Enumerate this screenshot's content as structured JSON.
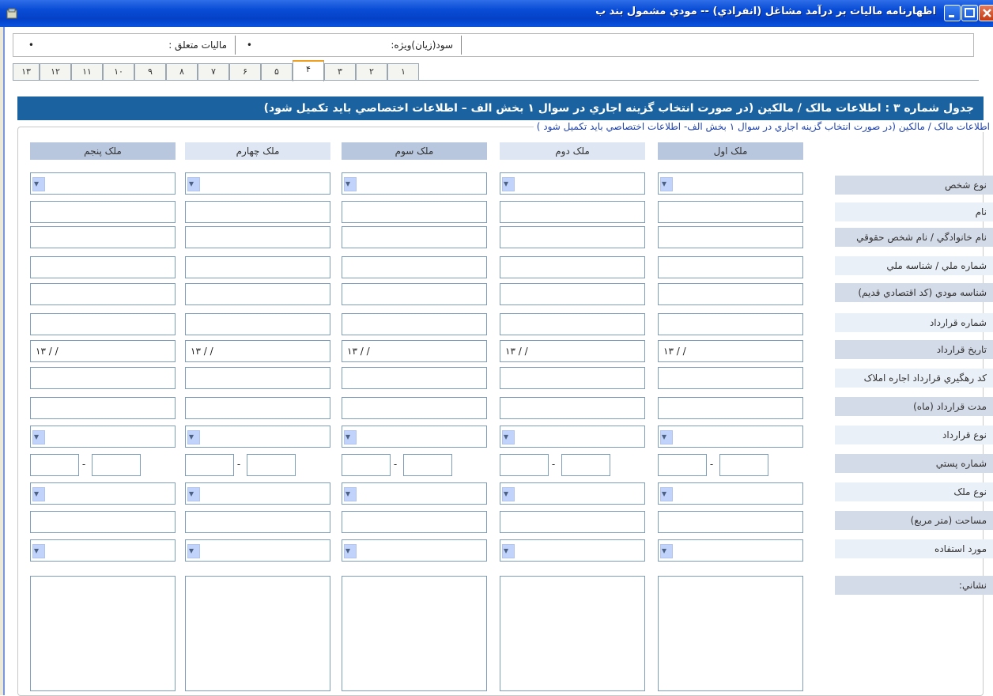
{
  "window": {
    "title": "اظهارنامه ماليات بر درآمد مشاغل (انفرادي) -- مودي مشمول بند ب"
  },
  "summary": {
    "profit_label": "سود(زيان)ويژه:",
    "profit_value": "•",
    "tax_label": "ماليات متعلق :",
    "tax_value": "•"
  },
  "tabs": [
    "۱",
    "۲",
    "۳",
    "۴",
    "۵",
    "۶",
    "۷",
    "۸",
    "۹",
    "۱۰",
    "۱۱",
    "۱۲",
    "۱۳"
  ],
  "active_tab": "۴",
  "section": {
    "header": "جدول شماره ۳ : اطلاعات مالک / مالکين (در صورت انتخاب گزينه اجاري در سوال ۱ بخش الف – اطلاعات اختصاصي بايد تکميل شود)",
    "group_label": "اطلاعات مالک / مالکين (در صورت انتخاب گزينه اجاري در سوال ۱ بخش الف- اطلاعات اختصاصي بايد تکميل شود )"
  },
  "columns": [
    "ملک اول",
    "ملک دوم",
    "ملک سوم",
    "ملک چهارم",
    "ملک پنجم"
  ],
  "rows": {
    "person_type": "نوع شخص",
    "name": "نام",
    "family": "نام خانوادگي / نام شخص حقوقي",
    "national_id": "شماره ملي / شناسه ملي",
    "taxpayer_id": "شناسه مودي (کد اقتصادي قديم)",
    "contract_no": "شماره قرارداد",
    "contract_date": "تاريخ قرارداد",
    "tracking_code": "کد رهگيري قرارداد اجاره املاک",
    "duration": "مدت قرارداد (ماه)",
    "contract_type": "نوع قرارداد",
    "postal_code": "شماره پستي",
    "property_type": "نوع ملک",
    "area": "مساحت (متر مربع)",
    "usage": "مورد استفاده",
    "address": "نشاني:"
  },
  "date_placeholder": "۱۳ / /",
  "postal_separator": "-"
}
